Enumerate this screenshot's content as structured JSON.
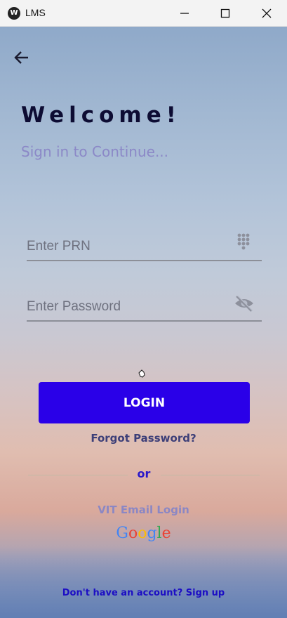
{
  "window": {
    "app_icon": "W",
    "title": "LMS",
    "controls": [
      "minimize-icon",
      "maximize-icon",
      "close-icon"
    ]
  },
  "nav": {
    "back_icon": "arrow-left-icon"
  },
  "header": {
    "title": "Welcome!",
    "subtitle": "Sign in to Continue..."
  },
  "form": {
    "prn": {
      "placeholder": "Enter PRN",
      "value": "",
      "icon": "dialpad-icon"
    },
    "password": {
      "placeholder": "Enter Password",
      "value": "",
      "icon": "eye-off-icon"
    }
  },
  "actions": {
    "login_label": "LOGIN",
    "forgot_label": "Forgot Password?",
    "divider_text": "or",
    "vit_login_label": "VIT Email Login",
    "google": {
      "letters": [
        "G",
        "o",
        "o",
        "g",
        "l",
        "e"
      ],
      "colors": [
        "#4285F4",
        "#EA4335",
        "#FBBC05",
        "#4285F4",
        "#34A853",
        "#EA4335"
      ]
    },
    "signup_label": "Don't have an account? Sign up"
  },
  "colors": {
    "primary": "#2a00e8",
    "title": "#0d0c33",
    "subtitle": "#8b88c7",
    "link": "#1c0ec4"
  }
}
